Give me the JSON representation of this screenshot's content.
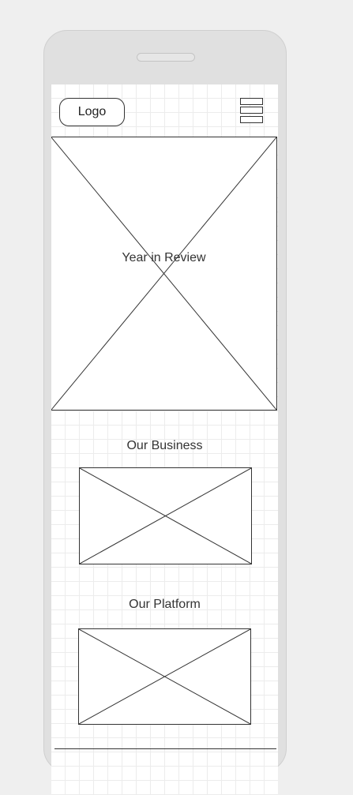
{
  "header": {
    "logo_label": "Logo"
  },
  "hero": {
    "title": "Year in Review"
  },
  "sections": [
    {
      "title": "Our Business"
    },
    {
      "title": "Our Platform"
    }
  ],
  "icons": {
    "menu": "hamburger-menu-icon",
    "image_placeholder": "image-placeholder-icon"
  }
}
